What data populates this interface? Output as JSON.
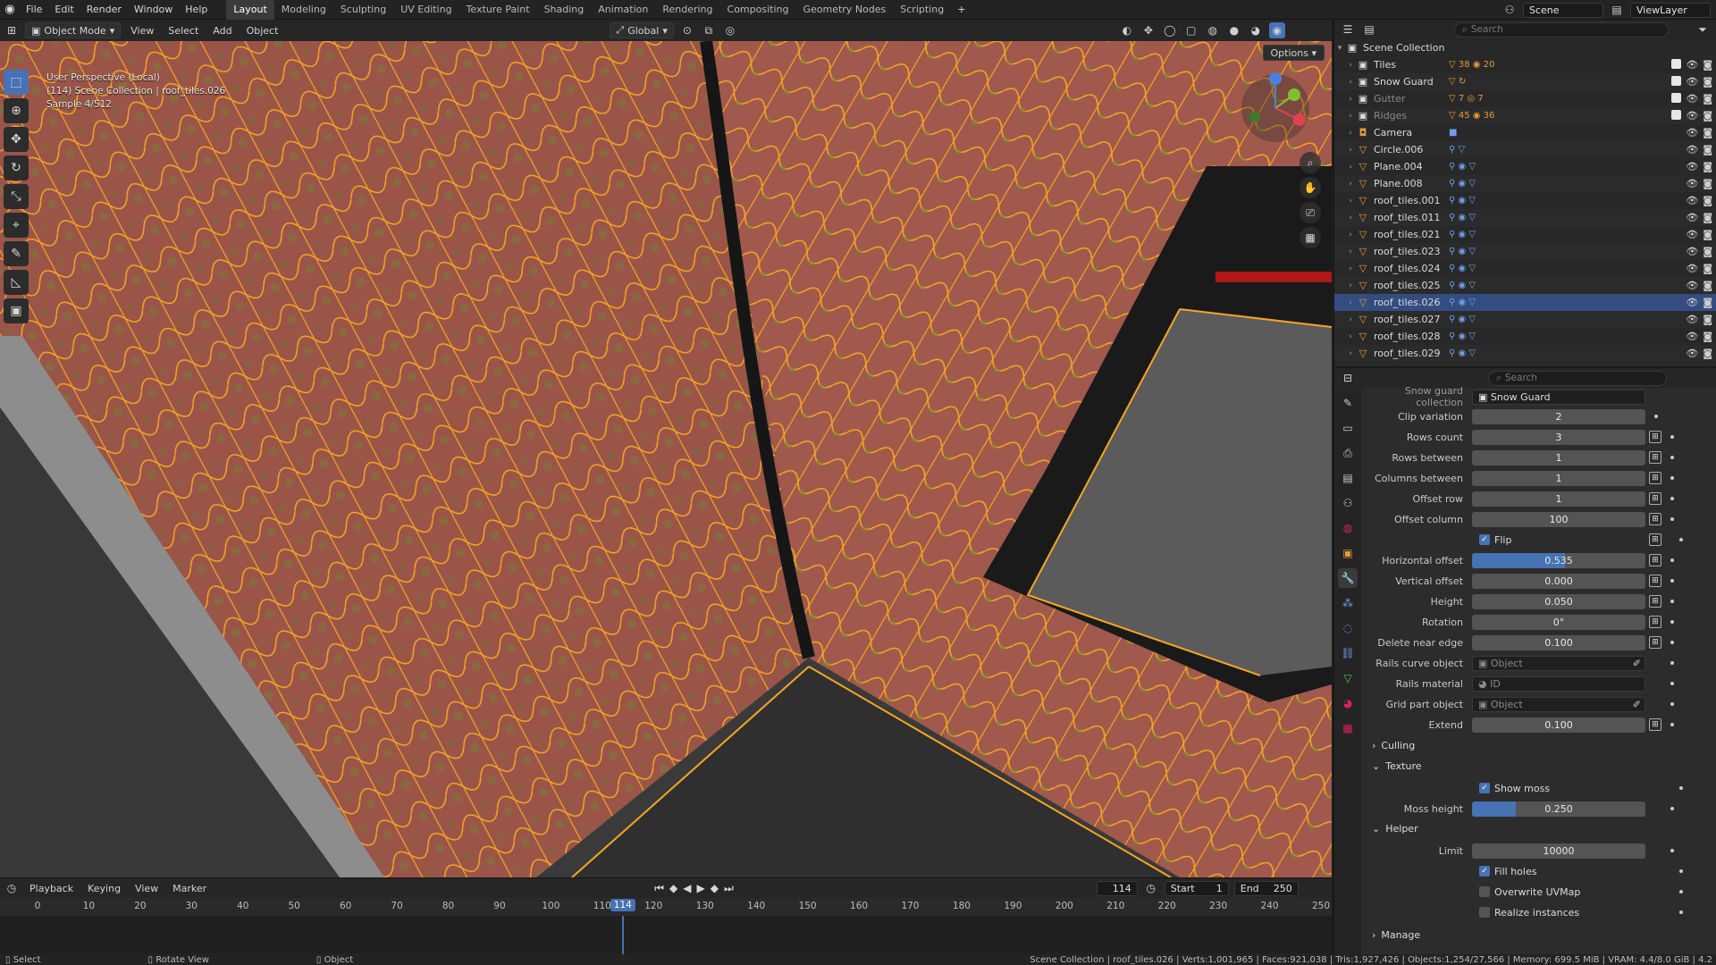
{
  "menu": [
    "File",
    "Edit",
    "Render",
    "Window",
    "Help"
  ],
  "workspaces": [
    "Layout",
    "Modeling",
    "Sculpting",
    "UV Editing",
    "Texture Paint",
    "Shading",
    "Animation",
    "Rendering",
    "Compositing",
    "Geometry Nodes",
    "Scripting"
  ],
  "add_tab": "+",
  "scene_name": "Scene",
  "view_layer": "ViewLayer",
  "viewport_header": {
    "mode": "Object Mode",
    "view": "View",
    "select": "Select",
    "add": "Add",
    "object": "Object",
    "orientation": "Global",
    "options": "Options"
  },
  "viewport_info": {
    "line1": "User Perspective (Local)",
    "line2": "(114) Scene Collection | roof_tiles.026",
    "line3": "Sample 4/512"
  },
  "outliner": {
    "search_placeholder": "Search",
    "root": "Scene Collection",
    "rows": [
      {
        "name": "Tiles",
        "type": "collection",
        "mods": "▽ 38 ◉ 20"
      },
      {
        "name": "Snow Guard",
        "type": "collection",
        "mods": "▽ ↻"
      },
      {
        "name": "Gutter",
        "type": "collection",
        "mods": "▽ 7 ◎ 7",
        "dim": true
      },
      {
        "name": "Ridges",
        "type": "collection",
        "mods": "▽ 45 ◉ 36",
        "dim": true
      },
      {
        "name": "Camera",
        "type": "camera",
        "mods": "■"
      },
      {
        "name": "Circle.006",
        "type": "mesh",
        "mods": "⚲ ▽"
      },
      {
        "name": "Plane.004",
        "type": "mesh",
        "mods": "⚲ ◉ ▽"
      },
      {
        "name": "Plane.008",
        "type": "mesh",
        "mods": "⚲ ◉ ▽"
      },
      {
        "name": "roof_tiles.001",
        "type": "mesh",
        "mods": "⚲ ◉ ▽"
      },
      {
        "name": "roof_tiles.011",
        "type": "mesh",
        "mods": "⚲ ◉ ▽"
      },
      {
        "name": "roof_tiles.021",
        "type": "mesh",
        "mods": "⚲ ◉ ▽"
      },
      {
        "name": "roof_tiles.023",
        "type": "mesh",
        "mods": "⚲ ◉ ▽"
      },
      {
        "name": "roof_tiles.024",
        "type": "mesh",
        "mods": "⚲ ◉ ▽"
      },
      {
        "name": "roof_tiles.025",
        "type": "mesh",
        "mods": "⚲ ◉ ▽"
      },
      {
        "name": "roof_tiles.026",
        "type": "mesh",
        "mods": "⚲ ◉ ▽",
        "selected": true
      },
      {
        "name": "roof_tiles.027",
        "type": "mesh",
        "mods": "⚲ ◉ ▽"
      },
      {
        "name": "roof_tiles.028",
        "type": "mesh",
        "mods": "⚲ ◉ ▽"
      },
      {
        "name": "roof_tiles.029",
        "type": "mesh",
        "mods": "⚲ ◉ ▽"
      }
    ]
  },
  "properties": {
    "search_placeholder": "Search",
    "snow_guard_collection_label": "Snow guard collection",
    "snow_guard_collection_value": "Snow Guard",
    "clip_variation": {
      "label": "Clip variation",
      "value": "2"
    },
    "rows_count": {
      "label": "Rows count",
      "value": "3"
    },
    "rows_between": {
      "label": "Rows between",
      "value": "1"
    },
    "columns_between": {
      "label": "Columns between",
      "value": "1"
    },
    "offset_row": {
      "label": "Offset row",
      "value": "1"
    },
    "offset_column": {
      "label": "Offset column",
      "value": "100"
    },
    "flip": {
      "label": "Flip",
      "checked": true
    },
    "horizontal_offset": {
      "label": "Horizontal offset",
      "value": "0.535",
      "fraction": 0.535
    },
    "vertical_offset": {
      "label": "Vertical offset",
      "value": "0.000"
    },
    "height": {
      "label": "Height",
      "value": "0.050"
    },
    "rotation": {
      "label": "Rotation",
      "value": "0°"
    },
    "delete_near_edge": {
      "label": "Delete near edge",
      "value": "0.100"
    },
    "rails_curve_object": {
      "label": "Rails curve object",
      "placeholder": "Object"
    },
    "rails_material": {
      "label": "Rails material",
      "placeholder": "ID"
    },
    "grid_part_object": {
      "label": "Grid part object",
      "placeholder": "Object"
    },
    "extend": {
      "label": "Extend",
      "value": "0.100"
    },
    "culling_panel": "Culling",
    "texture_panel": "Texture",
    "show_moss": {
      "label": "Show moss",
      "checked": true
    },
    "moss_height": {
      "label": "Moss height",
      "value": "0.250",
      "fraction": 0.25
    },
    "helper_panel": "Helper",
    "limit": {
      "label": "Limit",
      "value": "10000"
    },
    "fill_holes": {
      "label": "Fill holes",
      "checked": true
    },
    "overwrite_uvmap": {
      "label": "Overwrite UVMap",
      "checked": false
    },
    "realize_instances": {
      "label": "Realize instances",
      "checked": false
    },
    "manage_panel": "Manage"
  },
  "timeline": {
    "playback": "Playback",
    "keying": "Keying",
    "view": "View",
    "marker": "Marker",
    "current_frame": "114",
    "start_label": "Start",
    "start": "1",
    "end_label": "End",
    "end": "250",
    "ticks": [
      "0",
      "10",
      "20",
      "30",
      "40",
      "50",
      "60",
      "70",
      "80",
      "90",
      "100",
      "110",
      "120",
      "130",
      "140",
      "150",
      "160",
      "170",
      "180",
      "190",
      "200",
      "210",
      "220",
      "230",
      "240",
      "250"
    ]
  },
  "statusbar": {
    "select": "Select",
    "rotate_view": "Rotate View",
    "object": "Object",
    "stats": "Scene Collection | roof_tiles.026 | Verts:1,001,965 | Faces:921,038 | Tris:1,927,426 | Objects:1,254/27,566 | Memory: 699.5 MiB | VRAM: 4.4/8.0 GiB | 4.2"
  },
  "colors": {
    "accent": "#4772b3",
    "selection_outline": "#f5a623",
    "tile": "#9a5548",
    "moss": "#7a7a3a"
  }
}
